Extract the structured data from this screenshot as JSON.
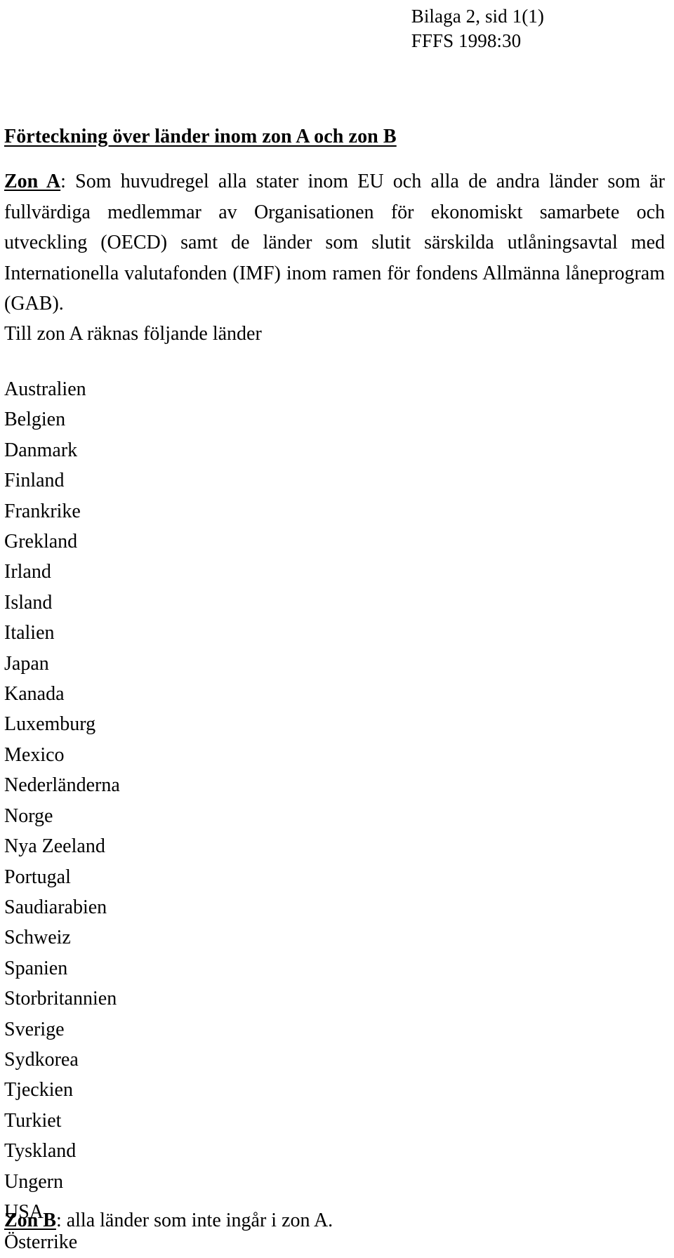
{
  "header": {
    "line1": "Bilaga 2, sid 1(1)",
    "line2": "FFFS 1998:30"
  },
  "title": "Förteckning över länder inom zon A och zon B",
  "zone_a": {
    "label": "Zon A",
    "body": ": Som huvudregel alla stater inom EU och alla de andra länder som är fullvärdiga medlemmar av Organisationen för ekonomiskt samarbete och utveckling (OECD) samt de länder som slutit särskilda utlåningsavtal med Internationella valutafonden (IMF) inom ramen för fondens Allmänna låneprogram (GAB)."
  },
  "list_intro": "Till zon A räknas följande länder",
  "countries": [
    "Australien",
    "Belgien",
    "Danmark",
    "Finland",
    "Frankrike",
    "Grekland",
    "Irland",
    "Island",
    "Italien",
    "Japan",
    "Kanada",
    "Luxemburg",
    "Mexico",
    "Nederländerna",
    "Norge",
    "Nya Zeeland",
    "Portugal",
    "Saudiarabien",
    "Schweiz",
    "Spanien",
    "Storbritannien",
    "Sverige",
    "Sydkorea",
    "Tjeckien",
    "Turkiet",
    "Tyskland",
    "Ungern",
    "USA",
    "Österrike"
  ],
  "zone_b": {
    "label": "Zon B",
    "body": ": alla länder som inte ingår i zon A."
  }
}
